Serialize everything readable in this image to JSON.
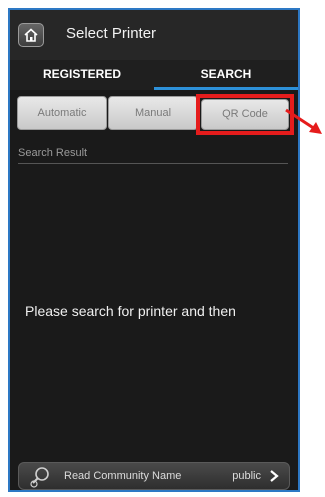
{
  "header": {
    "title": "Select Printer"
  },
  "tabs": [
    {
      "label": "REGISTERED",
      "active": false
    },
    {
      "label": "SEARCH",
      "active": true
    }
  ],
  "search_buttons": {
    "automatic": "Automatic",
    "manual": "Manual",
    "qr_code": "QR Code"
  },
  "search_result": {
    "label": "Search Result",
    "message": "Please search for printer and then"
  },
  "footer": {
    "label": "Read Community Name",
    "value": "public"
  },
  "colors": {
    "accent": "#2d91d9",
    "highlight": "#e51c1c",
    "background": "#1a1a1a"
  },
  "icons": [
    "home-icon",
    "settings-search-icon",
    "chevron-right-icon",
    "arrow-icon"
  ]
}
